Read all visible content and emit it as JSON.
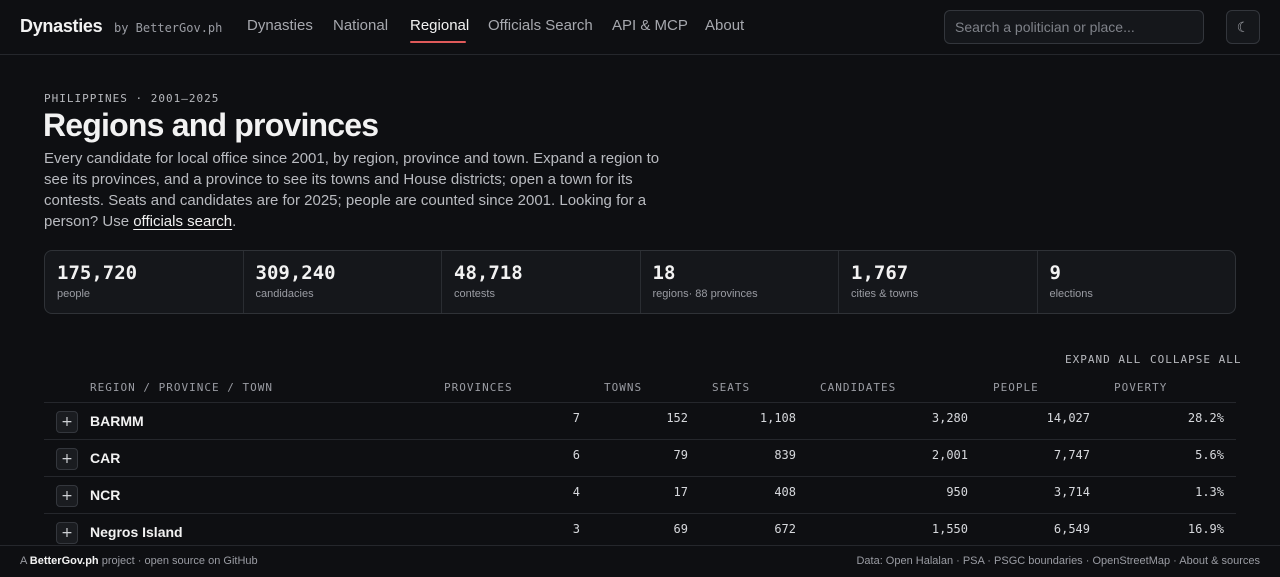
{
  "header": {
    "brand": "Dynasties",
    "brand_by": "by BetterGov.ph",
    "nav": [
      "Dynasties",
      "National",
      "Regional",
      "Officials Search",
      "API & MCP",
      "About"
    ],
    "active_nav": "Regional",
    "search_placeholder": "Search a politician or place...",
    "theme_icon": "moon-icon",
    "theme_glyph": "☾"
  },
  "intro": {
    "eyebrow": "PHILIPPINES · 2001–2025",
    "title": "Regions and provinces",
    "description": "Every candidate for local office since 2001, by region, province and town. Expand a region to see its provinces, and a province to see its towns and House districts; open a town for its contests. Seats and candidates are for 2025; people are counted since 2001. Looking for a person? Use ",
    "link_text": "officials search",
    "description_end": "."
  },
  "stats": [
    {
      "value": "175,720",
      "label": "people"
    },
    {
      "value": "309,240",
      "label": "candidacies"
    },
    {
      "value": "48,718",
      "label": "contests"
    },
    {
      "value": "18",
      "label": "regions· 88 provinces"
    },
    {
      "value": "1,767",
      "label": "cities & towns"
    },
    {
      "value": "9",
      "label": "elections"
    }
  ],
  "controls": {
    "expand_all": "EXPAND ALL",
    "collapse_all": "COLLAPSE ALL"
  },
  "table": {
    "columns": [
      "REGION / PROVINCE / TOWN",
      "PROVINCES",
      "TOWNS",
      "SEATS",
      "CANDIDATES",
      "PEOPLE",
      "POVERTY"
    ],
    "expand_glyph": "+",
    "rows": [
      {
        "name": "BARMM",
        "provinces": "7",
        "towns": "152",
        "seats": "1,108",
        "candidates": "3,280",
        "people": "14,027",
        "poverty": "28.2%"
      },
      {
        "name": "CAR",
        "provinces": "6",
        "towns": "79",
        "seats": "839",
        "candidates": "2,001",
        "people": "7,747",
        "poverty": "5.6%"
      },
      {
        "name": "NCR",
        "provinces": "4",
        "towns": "17",
        "seats": "408",
        "candidates": "950",
        "people": "3,714",
        "poverty": "1.3%"
      },
      {
        "name": "Negros Island",
        "provinces": "3",
        "towns": "69",
        "seats": "672",
        "candidates": "1,550",
        "people": "6,549",
        "poverty": "16.9%"
      }
    ]
  },
  "footer": {
    "prefix": "A ",
    "brand": "BetterGov.ph",
    "suffix": " project · open source on GitHub",
    "right": "Data: Open Halalan · PSA · PSGC boundaries · OpenStreetMap · About & sources"
  }
}
